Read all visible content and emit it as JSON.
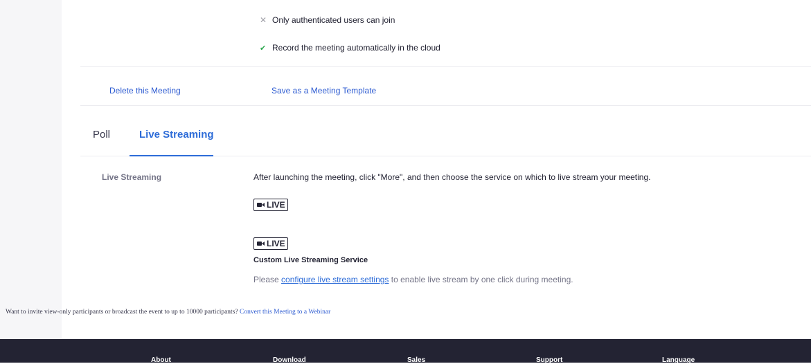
{
  "options": {
    "auth": {
      "icon": "x-icon",
      "label": "Only authenticated users can join"
    },
    "record": {
      "icon": "check-icon",
      "label": "Record the meeting automatically in the cloud"
    }
  },
  "actions": {
    "delete_label": "Delete this Meeting",
    "template_label": "Save as a Meeting Template"
  },
  "tabs": [
    {
      "label": "Poll",
      "active": false
    },
    {
      "label": "Live Streaming",
      "active": true
    }
  ],
  "live_streaming": {
    "field_label": "Live Streaming",
    "description": "After launching the meeting, click \"More\", and then choose the service on which to live stream your meeting.",
    "badge_label": "LIVE",
    "custom_service": {
      "title": "Custom Live Streaming Service",
      "note_prefix": "Please ",
      "note_link": "configure live stream settings",
      "note_suffix": " to enable live stream by one click during meeting."
    }
  },
  "webinar": {
    "text": "Want to invite view-only participants or broadcast the event to up to 10000 participants? ",
    "link": "Convert this Meeting to a Webinar"
  },
  "footer": {
    "items": [
      "About",
      "Download",
      "Sales",
      "Support",
      "Language"
    ]
  },
  "colors": {
    "accent": "#2d6cd8",
    "check": "#2da84f",
    "footer_bg": "#232333"
  }
}
